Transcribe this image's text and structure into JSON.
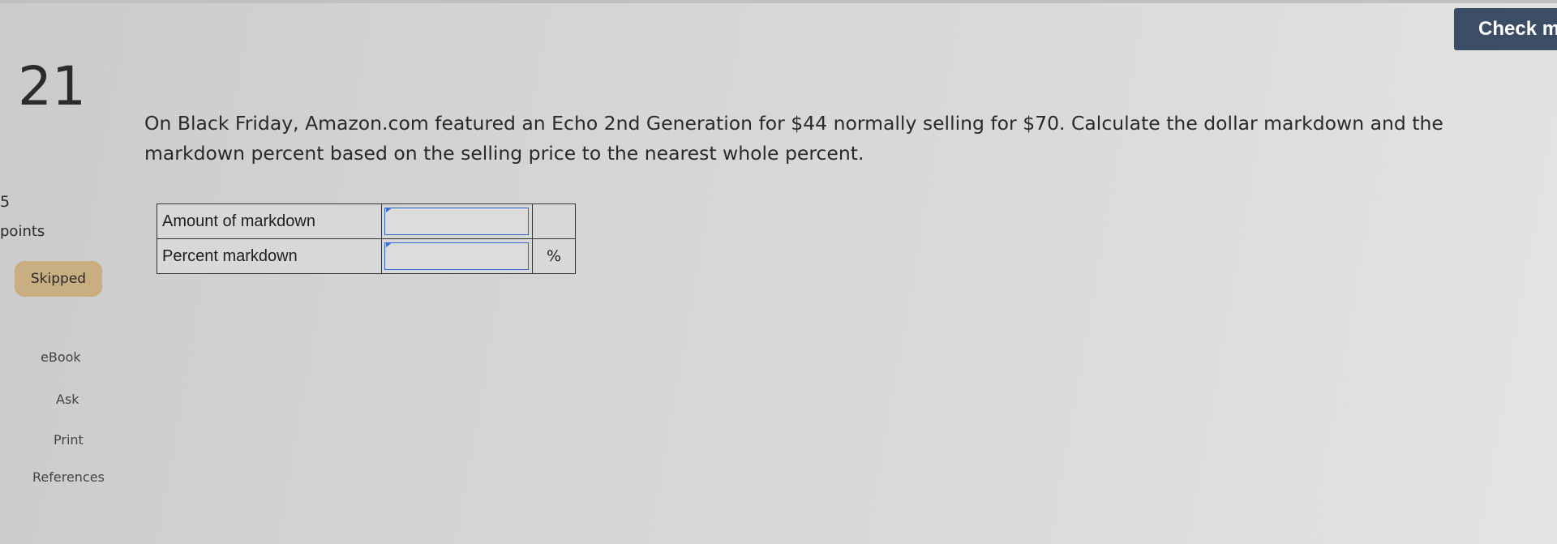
{
  "header": {
    "check_button_label": "Check m"
  },
  "question": {
    "number": "21",
    "text": "On Black Friday, Amazon.com featured an Echo 2nd Generation for $44 normally selling for $70. Calculate the dollar markdown and the markdown percent based on the selling price to the nearest whole percent."
  },
  "sidebar": {
    "points_value": "5",
    "points_label": "points",
    "status_badge": "Skipped",
    "links": {
      "ebook": "eBook",
      "ask": "Ask",
      "print": "Print",
      "references": "References"
    }
  },
  "answer_table": {
    "rows": [
      {
        "label": "Amount of markdown",
        "value": "",
        "unit": ""
      },
      {
        "label": "Percent markdown",
        "value": "",
        "unit": "%"
      }
    ]
  },
  "colors": {
    "check_button_bg": "#3c4d66",
    "skipped_badge_bg": "#c9ae82",
    "input_border": "#2f65c9"
  }
}
